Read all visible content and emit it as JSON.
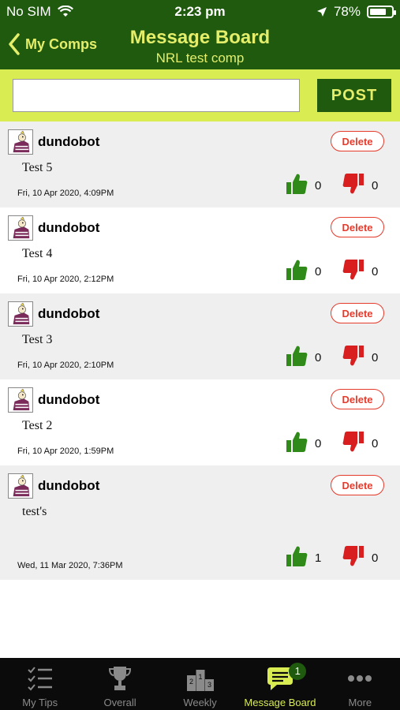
{
  "status_bar": {
    "carrier": "No SIM",
    "time": "2:23 pm",
    "battery_percent": "78%",
    "battery_level": 0.78
  },
  "nav": {
    "back_label": "My Comps",
    "title": "Message Board",
    "subtitle": "NRL test comp"
  },
  "post_bar": {
    "input_value": "",
    "placeholder": "",
    "post_label": "POST"
  },
  "messages": [
    {
      "user": "dundobot",
      "text": "Test 5",
      "date": "Fri, 10 Apr 2020, 4:09PM",
      "likes": "0",
      "dislikes": "0",
      "delete_label": "Delete"
    },
    {
      "user": "dundobot",
      "text": "Test 4",
      "date": "Fri, 10 Apr 2020, 2:12PM",
      "likes": "0",
      "dislikes": "0",
      "delete_label": "Delete"
    },
    {
      "user": "dundobot",
      "text": "Test 3",
      "date": "Fri, 10 Apr 2020, 2:10PM",
      "likes": "0",
      "dislikes": "0",
      "delete_label": "Delete"
    },
    {
      "user": "dundobot",
      "text": "Test 2",
      "date": "Fri, 10 Apr 2020, 1:59PM",
      "likes": "0",
      "dislikes": "0",
      "delete_label": "Delete"
    },
    {
      "user": "dundobot",
      "text": "test's",
      "date": "Wed, 11 Mar 2020, 7:36PM",
      "likes": "1",
      "dislikes": "0",
      "delete_label": "Delete"
    }
  ],
  "tabs": [
    {
      "label": "My Tips",
      "icon": "checklist-icon"
    },
    {
      "label": "Overall",
      "icon": "trophy-icon"
    },
    {
      "label": "Weekly",
      "icon": "podium-icon"
    },
    {
      "label": "Message Board",
      "icon": "message-icon",
      "badge": "1",
      "active": true
    },
    {
      "label": "More",
      "icon": "more-dots-icon"
    }
  ],
  "colors": {
    "header": "#1f5a0e",
    "accent": "#d9ec51",
    "title": "#e4ee6a",
    "delete": "#e53b2c",
    "thumb_up": "#2f8a1a",
    "thumb_down": "#d81e1e"
  }
}
